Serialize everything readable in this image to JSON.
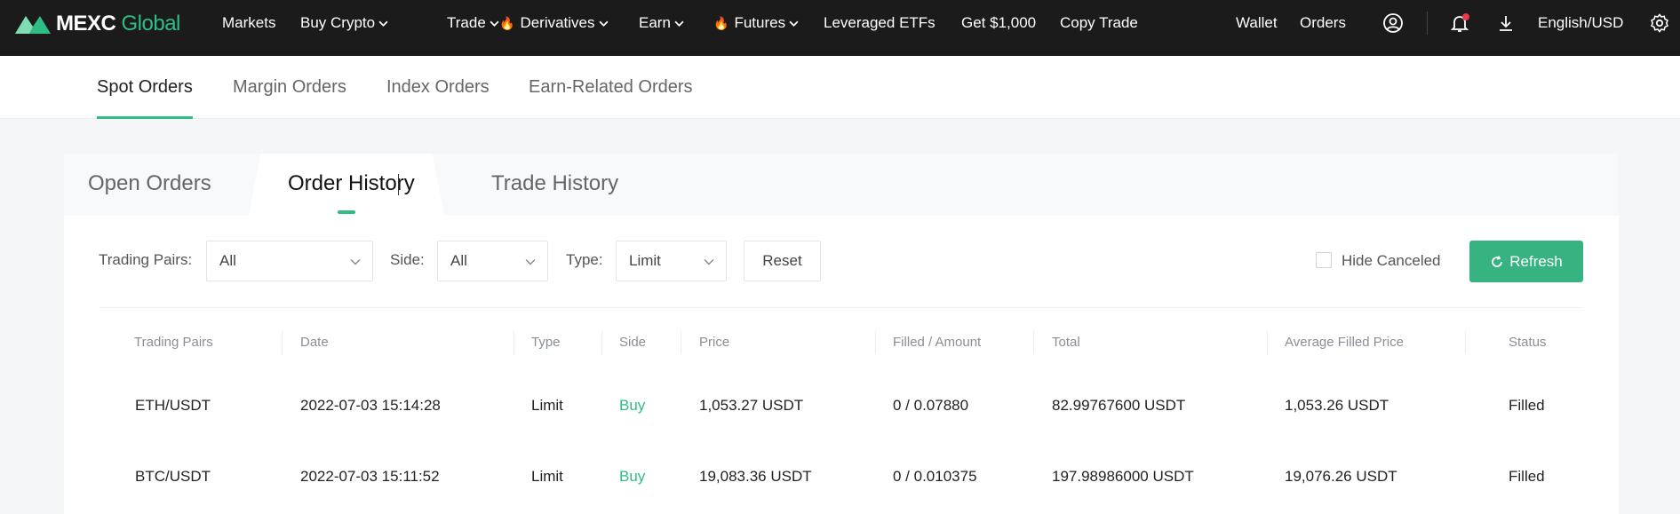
{
  "brand": {
    "name_part1": "MEXC",
    "name_part2": "Global",
    "accent": "#2ebd85"
  },
  "topnav": {
    "items": [
      {
        "label": "Markets",
        "dropdown": false,
        "hot": false
      },
      {
        "label": "Buy Crypto",
        "dropdown": true,
        "hot": false
      },
      {
        "label": "Trade",
        "dropdown": true,
        "hot": false
      },
      {
        "label": "Derivatives",
        "dropdown": true,
        "hot": true
      },
      {
        "label": "Earn",
        "dropdown": true,
        "hot": false
      },
      {
        "label": "Futures",
        "dropdown": true,
        "hot": true
      },
      {
        "label": "Leveraged ETFs",
        "dropdown": false,
        "hot": false
      },
      {
        "label": "Get $1,000",
        "dropdown": false,
        "hot": false
      },
      {
        "label": "Copy Trade",
        "dropdown": false,
        "hot": false
      }
    ],
    "right": {
      "wallet": "Wallet",
      "orders": "Orders",
      "language": "English/USD"
    },
    "icons": [
      "user-icon",
      "bell-icon",
      "download-icon",
      "gear-icon"
    ]
  },
  "subtabs": [
    {
      "label": "Spot Orders",
      "active": true
    },
    {
      "label": "Margin Orders",
      "active": false
    },
    {
      "label": "Index Orders",
      "active": false
    },
    {
      "label": "Earn-Related Orders",
      "active": false
    }
  ],
  "panel_tabs": [
    {
      "label": "Open Orders",
      "active": false
    },
    {
      "label": "Order History",
      "active": true
    },
    {
      "label": "Trade History",
      "active": false
    }
  ],
  "filters": {
    "trading_pairs": {
      "label": "Trading Pairs",
      "value": "All"
    },
    "side": {
      "label": "Side",
      "value": "All"
    },
    "type": {
      "label": "Type",
      "value": "Limit"
    },
    "reset": "Reset",
    "hide_canceled": {
      "label": "Hide Canceled",
      "checked": false
    },
    "refresh": "Refresh"
  },
  "table": {
    "headers": [
      "Trading Pairs",
      "Date",
      "Type",
      "Side",
      "Price",
      "Filled / Amount",
      "Total",
      "Average Filled Price",
      "Status"
    ],
    "rows": [
      [
        "ETH/USDT",
        "2022-07-03 15:14:28",
        "Limit",
        "Buy",
        "1,053.27 USDT",
        "0 / 0.07880",
        "82.99767600 USDT",
        "1,053.26 USDT",
        "Filled"
      ],
      [
        "BTC/USDT",
        "2022-07-03 15:11:52",
        "Limit",
        "Buy",
        "19,083.36 USDT",
        "0 / 0.010375",
        "197.98986000 USDT",
        "19,076.26 USDT",
        "Filled"
      ]
    ]
  }
}
